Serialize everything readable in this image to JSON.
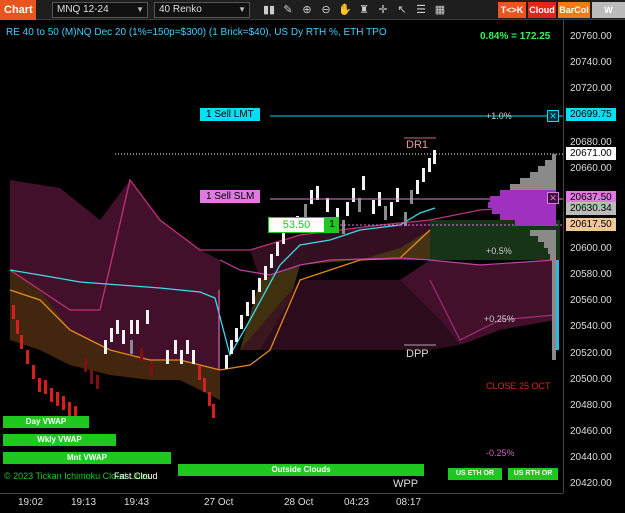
{
  "toolbar": {
    "chart_tab": "Chart",
    "symbol": "MNQ 12-24",
    "bar_type": "40 Renko",
    "btn_tk": "T<>K",
    "btn_cloud": "Cloud",
    "btn_barcol": "BarCol",
    "btn_w": "W VWAA",
    "icons": [
      "bars-icon",
      "draw-icon",
      "zoom-in-icon",
      "zoom-out-icon",
      "hand-icon",
      "strategy-icon",
      "crosshair-icon",
      "arrow-icon",
      "properties-icon",
      "data-box-icon"
    ]
  },
  "chart": {
    "title": "RE 40 to 50 (M)NQ Dec 20 (1%=150p=$300) (1 Brick=$40), US Dy RTH %, ETH TPO",
    "pct_readout": "0.84% = 172.25",
    "orders": {
      "sell_lmt": "1 Sell LMT",
      "sell_slm": "1 Sell SLM",
      "position_price": "53.50",
      "position_qty": "1"
    },
    "levels": {
      "dr1": "DR1",
      "dpp": "DPP",
      "wpp": "WPP",
      "plus_1": "+1.0%",
      "plus_05": "+0.5%",
      "plus_025": "+0.25%",
      "minus_025": "-0.25%",
      "close": "CLOSE 25 OCT"
    },
    "price_tags": {
      "sell_lmt_price": "20699.75",
      "last_price": "20671.00",
      "sell_slm_price": "20637.50",
      "hidden_price": "20630.34",
      "avg_price": "20617.50"
    },
    "bottom_labels": {
      "day_vwap": "Day VWAP",
      "wkly_vwap": "Wkly VWAP",
      "mnt_vwap": "Mnt VWAP",
      "copyright": "© 2023 Tickan Ichimoku Cloud Lines",
      "fast_cloud": "Fast Cloud",
      "outside_clouds": "Outside Clouds",
      "us_eth": "US ETH OR",
      "us_rth": "US RTH OR"
    },
    "price_axis": [
      "20760.00",
      "20740.00",
      "20720.00",
      "20680.00",
      "20660.00",
      "20600.00",
      "20580.00",
      "20560.00",
      "20540.00",
      "20520.00",
      "20500.00",
      "20480.00",
      "20460.00",
      "20440.00",
      "20420.00"
    ],
    "time_axis": [
      "19:02",
      "19:13",
      "19:43",
      "27 Oct",
      "28 Oct",
      "04:23",
      "08:17"
    ]
  },
  "colors": {
    "accent": "#e8551f",
    "cyan_order": "#00e0ff",
    "slm": "#e07ae0",
    "green": "#1ec81e",
    "cloud": "#5a1a3a"
  }
}
